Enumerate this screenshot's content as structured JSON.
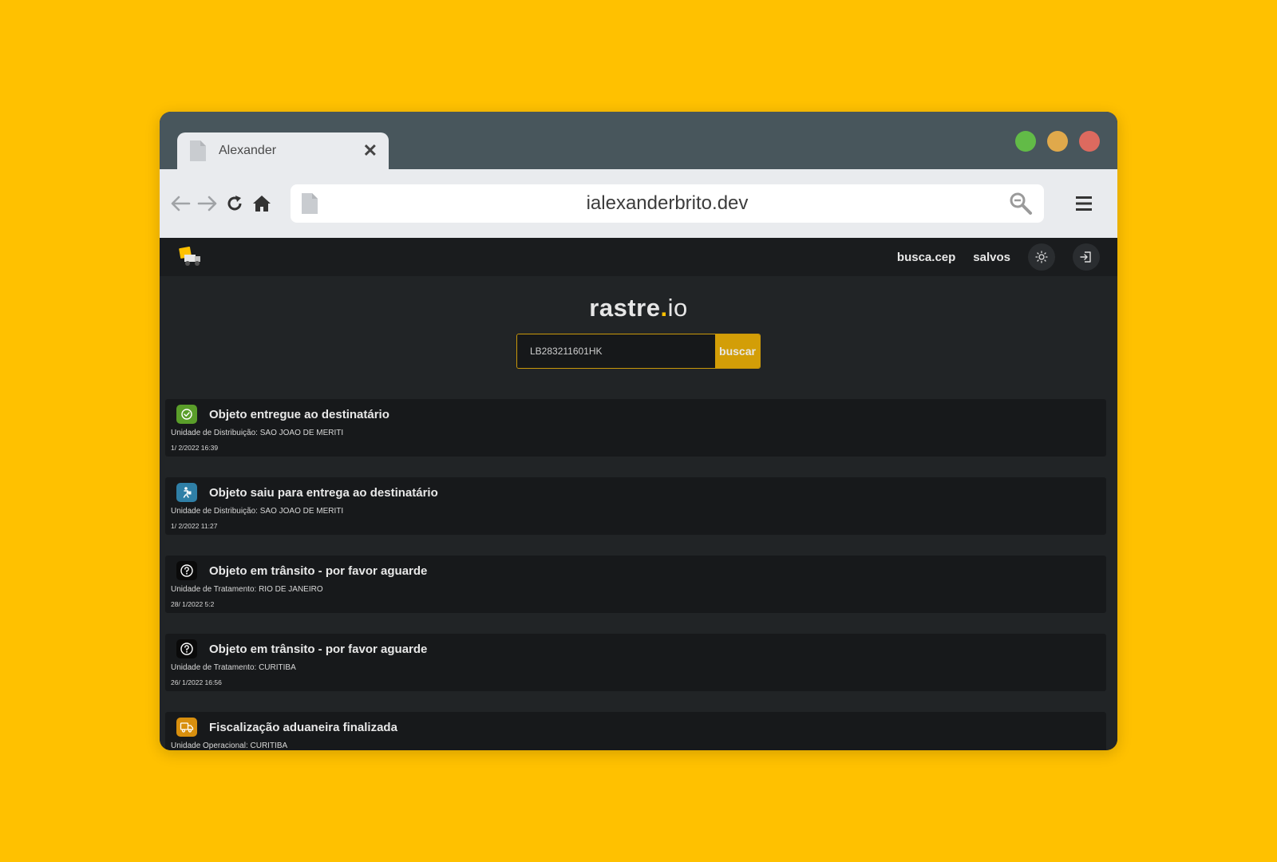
{
  "browser": {
    "tab_title": "Alexander",
    "url": "ialexanderbrito.dev",
    "window_controls": {
      "green": "#62BB47",
      "yellow": "#E0A94B",
      "red": "#DD6A5F"
    }
  },
  "app": {
    "nav": {
      "busca_cep": "busca.cep",
      "salvos": "salvos"
    },
    "brand": {
      "main": "rastre",
      "dot": ".",
      "suffix": "io"
    },
    "search": {
      "value": "LB283211601HK",
      "button": "buscar"
    },
    "events": [
      {
        "title": "Objeto entregue ao destinatário",
        "location": "Unidade de Distribuição: SAO JOAO DE MERITI",
        "time": "1/ 2/2022 16:39",
        "icon": "check-circle-icon",
        "color": "#5A9E2A"
      },
      {
        "title": "Objeto saiu para entrega ao destinatário",
        "location": "Unidade de Distribuição: SAO JOAO DE MERITI",
        "time": "1/ 2/2022 11:27",
        "icon": "delivery-person-icon",
        "color": "#2F7FA6"
      },
      {
        "title": "Objeto em trânsito - por favor aguarde",
        "location": "Unidade de Tratamento: RIO DE JANEIRO",
        "time": "28/ 1/2022 5:2",
        "icon": "question-circle-icon",
        "color": "#0A0A0A"
      },
      {
        "title": "Objeto em trânsito - por favor aguarde",
        "location": "Unidade de Tratamento: CURITIBA",
        "time": "26/ 1/2022 16:56",
        "icon": "question-circle-icon",
        "color": "#0A0A0A"
      },
      {
        "title": "Fiscalização aduaneira finalizada",
        "location": "Unidade Operacional: CURITIBA",
        "time": "",
        "icon": "truck-icon",
        "color": "#D88F0E"
      }
    ]
  }
}
